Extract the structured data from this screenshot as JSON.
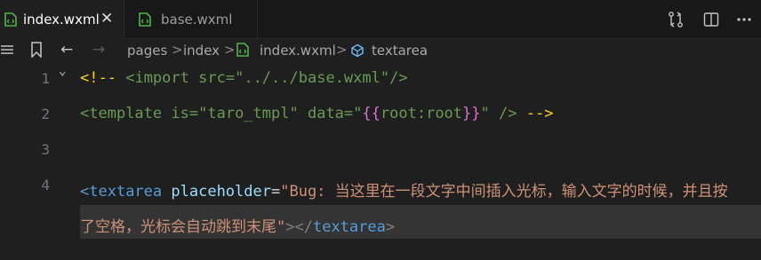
{
  "tabs": [
    {
      "label": "index.wxml",
      "close": "✕",
      "active": true
    },
    {
      "label": "base.wxml",
      "active": false
    }
  ],
  "colors": {
    "tab_file_icon": "#4fb34a",
    "accent_tag": "#569cd6",
    "string": "#ce9178"
  },
  "breadcrumb": {
    "items": [
      "pages",
      "index",
      "index.wxml",
      "textarea"
    ],
    "separator": ">"
  },
  "editor": {
    "line_numbers": [
      "1",
      "2",
      "3",
      "4"
    ],
    "line1": {
      "comment_open": "<!--",
      "import_lt": "<",
      "import_tag": "import",
      "attr": "src",
      "eq": "=",
      "value": "\"../../base.wxml\"",
      "close": "/>"
    },
    "line2": {
      "lt": "<",
      "tag": "template",
      "attr1": "is",
      "eq1": "=",
      "val1": "\"taro_tmpl\"",
      "attr2": "data",
      "eq2": "=",
      "quote_open": "\"",
      "braces_open": "{{",
      "expr": "root:root",
      "braces_close": "}}",
      "quote_close": "\"",
      "self_close": "/>",
      "comment_close": "-->"
    },
    "line4": {
      "lt": "<",
      "tag": "textarea",
      "attr": "placeholder",
      "eq": "=",
      "value": "\"Bug: 当这里在一段文字中间插入光标，输入文字的时候，并且按了空格，光标会自动跳到末尾\"",
      "gt": ">",
      "close_lt": "</",
      "close_tag": "textarea",
      "close_gt": ">"
    }
  }
}
